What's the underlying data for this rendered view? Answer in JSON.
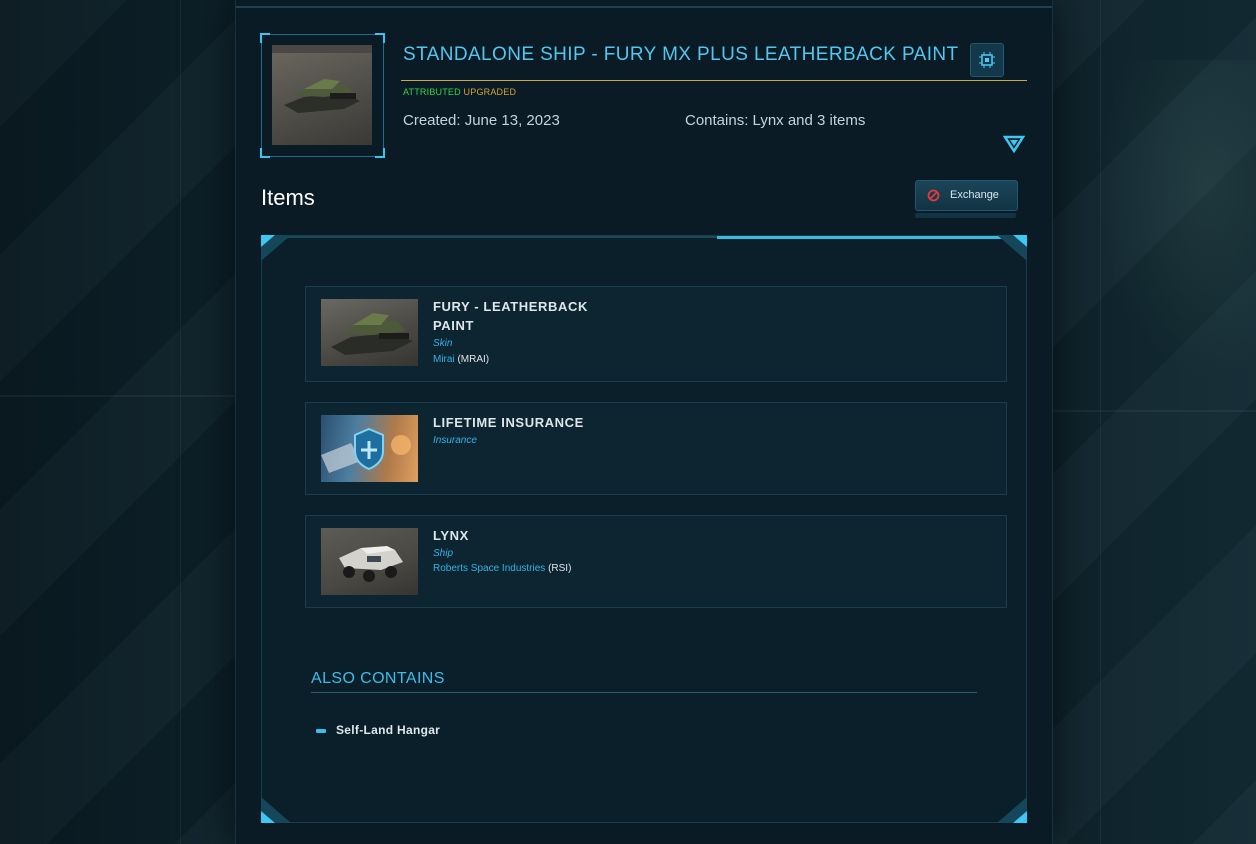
{
  "package": {
    "title": "STANDALONE SHIP - FURY MX PLUS LEATHERBACK PAINT",
    "badge_attributed": "ATTRIBUTED",
    "badge_upgraded": "UPGRADED",
    "created": "Created: June 13, 2023",
    "contains": "Contains: Lynx and 3 items",
    "thumbnail_icon": "fury-ship-thumbnail",
    "chip_icon": "chip-icon",
    "expand_icon": "chevron-down-icon"
  },
  "items_section": {
    "heading": "Items",
    "exchange_label": "Exchange",
    "exchange_icon": "no-entry-icon",
    "items": [
      {
        "name": "FURY - LEATHERBACK PAINT",
        "type": "Skin",
        "maker": "Mirai",
        "maker_code": "(MRAI)",
        "icon": "fury-paint-thumbnail"
      },
      {
        "name": "LIFETIME INSURANCE",
        "type": "Insurance",
        "maker": "",
        "maker_code": "",
        "icon": "insurance-shield-thumbnail"
      },
      {
        "name": "LYNX",
        "type": "Ship",
        "maker": "Roberts Space Industries",
        "maker_code": "(RSI)",
        "icon": "lynx-rover-thumbnail"
      }
    ]
  },
  "also_contains": {
    "heading": "ALSO CONTAINS",
    "items": [
      "Self-Land Hangar"
    ]
  },
  "colors": {
    "accent": "#52c7ef",
    "attributed": "#35d64a",
    "upgraded": "#d8a234",
    "panel_bg": "#0a1b25",
    "title_underline": "#c8a850"
  }
}
